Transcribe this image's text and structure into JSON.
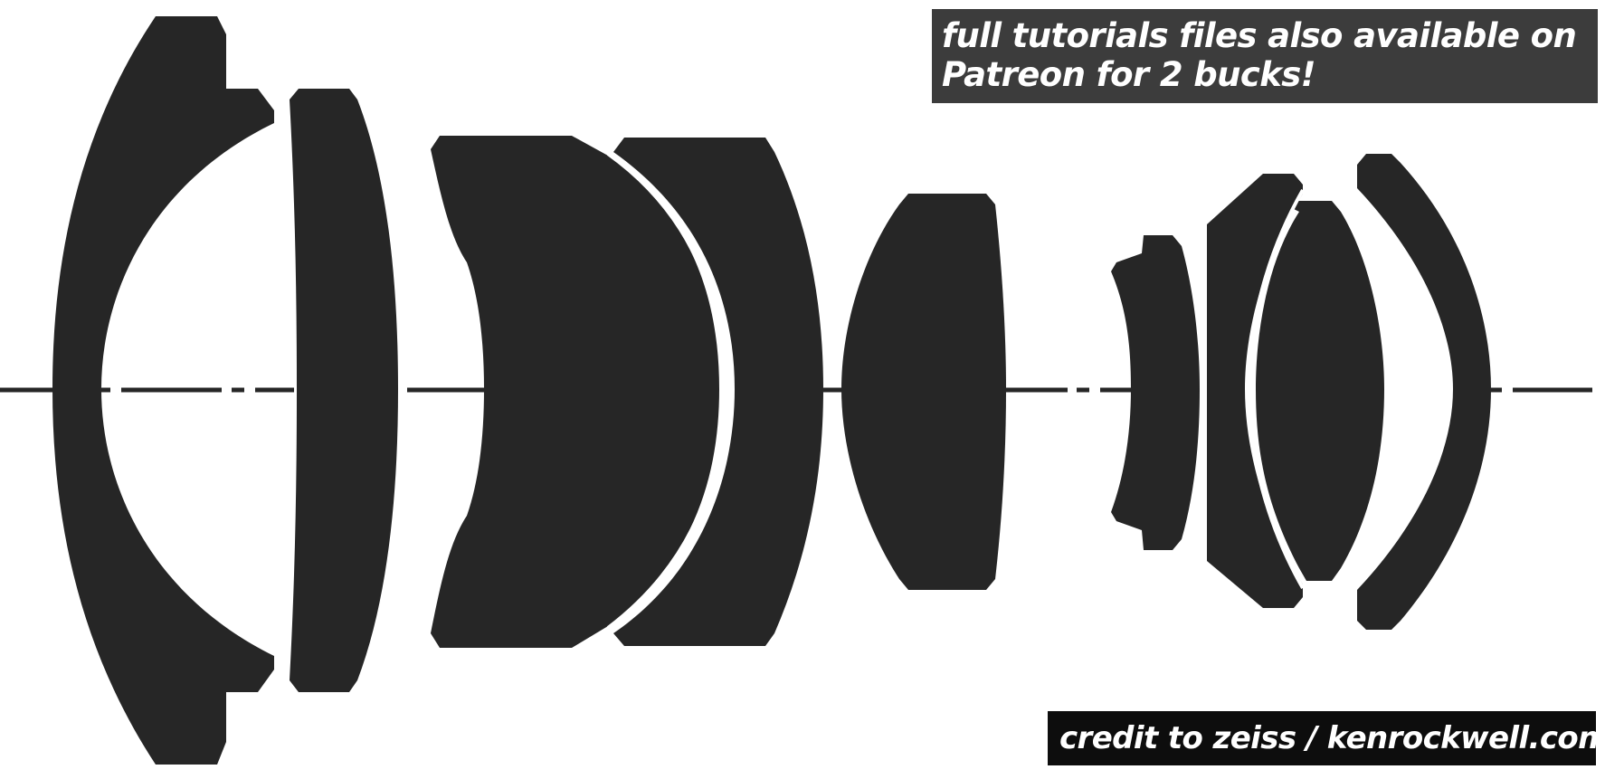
{
  "notes": {
    "patreon_line_1": "full tutorials files also available on",
    "patreon_line_2": "Patreon for 2 bucks!",
    "credit": "credit to zeiss / kenrockwell.com"
  },
  "colors": {
    "lens_fill": "#262626",
    "axis_line": "#262626",
    "background": "#ffffff",
    "patreon_banner_bg": "#3c3c3c",
    "credit_banner_bg": "#0d0d0d",
    "banner_text": "#ffffff"
  },
  "diagram": {
    "type": "lens cross-section (optical element layout)",
    "elements": [
      {
        "name": "element-1",
        "shape": "meniscus with flanged edge"
      },
      {
        "name": "element-2",
        "shape": "thin convex"
      },
      {
        "name": "element-3",
        "shape": "cemented half (front)"
      },
      {
        "name": "element-4",
        "shape": "cemented half (rear)"
      },
      {
        "name": "element-5",
        "shape": "biconvex"
      },
      {
        "name": "element-6",
        "shape": "concave with flange"
      },
      {
        "name": "element-7",
        "shape": "cemented half (front)"
      },
      {
        "name": "element-8",
        "shape": "biconvex (inner)"
      },
      {
        "name": "element-9",
        "shape": "meniscus"
      }
    ],
    "optical_axis": "dash-dot centre line"
  }
}
